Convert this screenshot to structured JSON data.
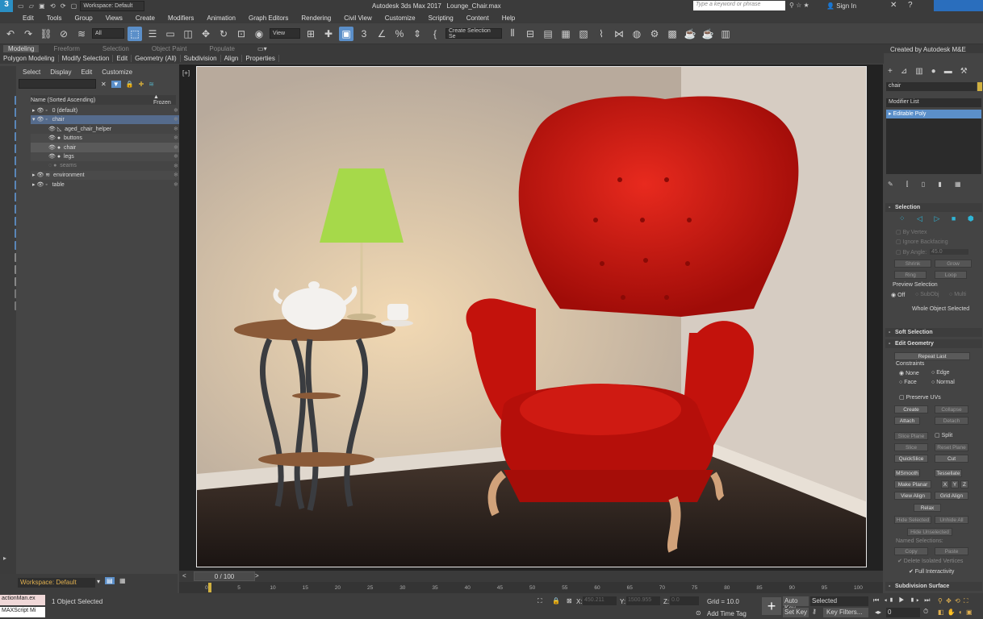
{
  "app": {
    "title": "Autodesk 3ds Max 2017",
    "file": "Lounge_Chair.max",
    "workspace": "Workspace: Default",
    "search_placeholder": "Type a keyword or phrase",
    "sign_in": "Sign In",
    "created_by": "Created by Autodesk M&E"
  },
  "menu": [
    "Edit",
    "Tools",
    "Group",
    "Views",
    "Create",
    "Modifiers",
    "Animation",
    "Graph Editors",
    "Rendering",
    "Civil View",
    "Customize",
    "Scripting",
    "Content",
    "Help"
  ],
  "toolbar": {
    "filter": "All",
    "view": "View",
    "selection_set": "Create Selection Se"
  },
  "ribbon": {
    "tabs": [
      "Modeling",
      "Freeform",
      "Selection",
      "Object Paint",
      "Populate"
    ],
    "active_tab": "Modeling",
    "panels": [
      "Polygon Modeling",
      "Modify Selection",
      "Edit",
      "Geometry (All)",
      "Subdivision",
      "Align",
      "Properties"
    ]
  },
  "scene_explorer": {
    "tabs": [
      "Select",
      "Display",
      "Edit",
      "Customize"
    ],
    "col_name": "Name (Sorted Ascending)",
    "col_frozen": "▲ Frozen",
    "rows": [
      {
        "name": "0 (default)"
      },
      {
        "name": "chair"
      },
      {
        "name": "aged_chair_helper"
      },
      {
        "name": "buttons"
      },
      {
        "name": "chair"
      },
      {
        "name": "legs"
      },
      {
        "name": "seams"
      },
      {
        "name": "environment"
      },
      {
        "name": "table"
      }
    ]
  },
  "viewport": {
    "label": "[+]"
  },
  "timeline": {
    "frame": "0 / 100",
    "ticks": [
      "0",
      "5",
      "10",
      "15",
      "20",
      "25",
      "30",
      "35",
      "40",
      "45",
      "50",
      "55",
      "60",
      "65",
      "70",
      "75",
      "80",
      "85",
      "90",
      "95",
      "100"
    ]
  },
  "status": {
    "script_a": "actionMan.ex",
    "script_b": "MAXScript Mi",
    "message": "1 Object Selected",
    "x_label": "X:",
    "x_val": "450.211",
    "y_label": "Y:",
    "y_val": "1500.955",
    "z_label": "Z:",
    "z_val": "0.0",
    "grid": "Grid = 10.0",
    "add_time_tag": "Add Time Tag",
    "auto_key": "Auto Key",
    "key_mode": "Selected",
    "set_key": "Set Key",
    "key_filters": "Key Filters...",
    "frame_field": "0"
  },
  "command_panel": {
    "object_name": "chair",
    "modifier_list": "Modifier List",
    "stack_item": "Editable Poly",
    "selection": {
      "title": "Selection",
      "by_vertex": "By Vertex",
      "ignore_backfacing": "Ignore Backfacing",
      "by_angle": "By Angle:",
      "angle_val": "45.0",
      "shrink": "Shrink",
      "grow": "Grow",
      "ring": "Ring",
      "loop": "Loop",
      "preview": "Preview Selection",
      "off": "Off",
      "subobj": "SubObj",
      "multi": "Multi",
      "whole": "Whole Object Selected"
    },
    "soft_selection": "Soft Selection",
    "edit_geometry": {
      "title": "Edit Geometry",
      "repeat_last": "Repeat Last",
      "constraints": "Constraints",
      "none": "None",
      "edge": "Edge",
      "face": "Face",
      "normal": "Normal",
      "preserve_uvs": "Preserve UVs",
      "create": "Create",
      "collapse": "Collapse",
      "attach": "Attach",
      "detach": "Detach",
      "slice_plane": "Slice Plane",
      "split": "Split",
      "slice": "Slice",
      "reset_plane": "Reset Plane",
      "quickslice": "QuickSlice",
      "cut": "Cut",
      "msmooth": "MSmooth",
      "tessellate": "Tessellate",
      "make_planar": "Make Planar",
      "x": "X",
      "y": "Y",
      "z": "Z",
      "view_align": "View Align",
      "grid_align": "Grid Align",
      "relax": "Relax",
      "hide_selected": "Hide Selected",
      "unhide_all": "Unhide All",
      "hide_unselected": "Hide Unselected",
      "named_selections": "Named Selections:",
      "copy": "Copy",
      "paste": "Paste",
      "delete_isolated": "✔ Delete Isolated Vertices",
      "full_interactivity": "✔ Full Interactivity"
    },
    "subdivision_surface": "Subdivision Surface"
  },
  "colors": {
    "chair": "#d0150f",
    "lamp_shade": "#a6d94a",
    "selection": "#5b8fc9"
  }
}
